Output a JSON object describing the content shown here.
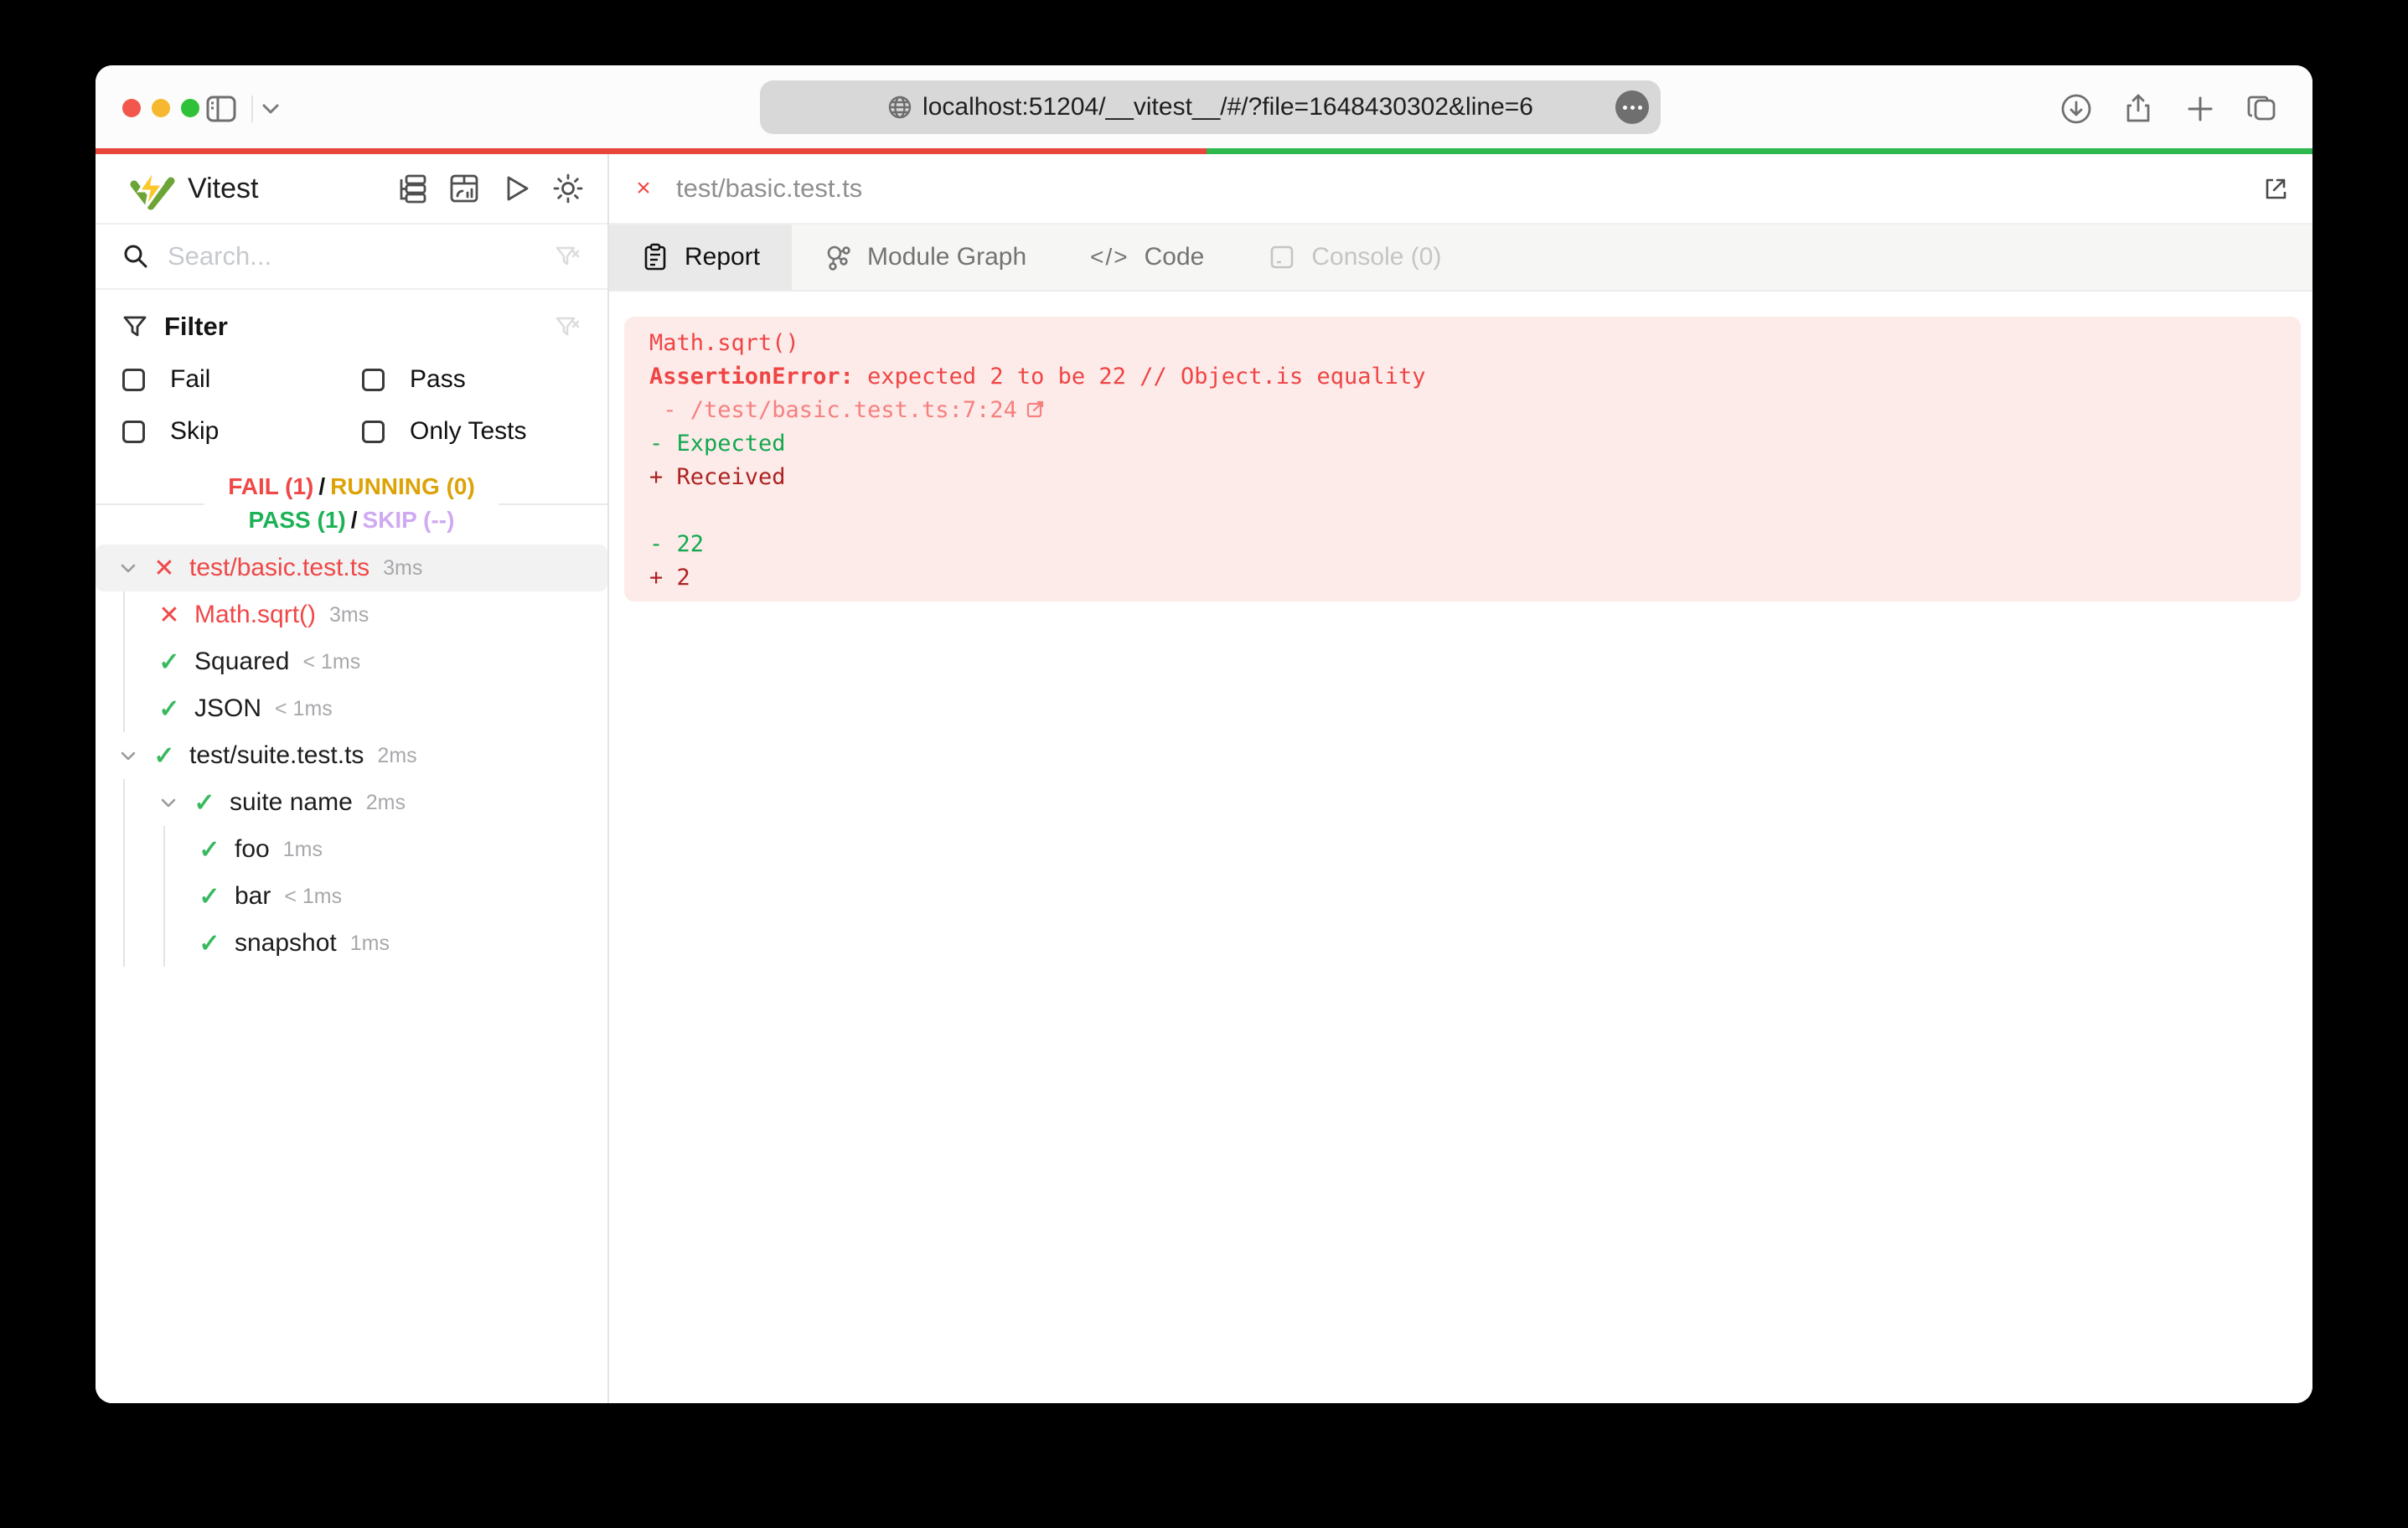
{
  "browser": {
    "url": "localhost:51204/__vitest__/#/?file=1648430302&line=6",
    "toolbar_icons": [
      "sidebar-toggle",
      "chevron-down",
      "globe",
      "page-settings-ellipsis",
      "downloads",
      "share",
      "new-tab",
      "tab-overview"
    ],
    "progress_colors": {
      "fail": "#e8453c",
      "pass": "#2eb84e"
    }
  },
  "app": {
    "title": "Vitest",
    "header_icons": [
      "list-tree",
      "dashboard",
      "run-all",
      "theme-toggle"
    ],
    "search": {
      "placeholder": "Search...",
      "value": ""
    },
    "filter": {
      "title": "Filter",
      "options": [
        "Fail",
        "Pass",
        "Skip",
        "Only Tests"
      ],
      "checked": [
        false,
        false,
        false,
        false
      ]
    },
    "summary": {
      "fail": "FAIL (1)",
      "running": "RUNNING (0)",
      "pass": "PASS (1)",
      "skip": "SKIP (--)",
      "sep": "/"
    },
    "tree": [
      {
        "name": "test/basic.test.ts",
        "duration": "3ms",
        "status": "fail",
        "depth": 0,
        "expandable": true,
        "selected": true
      },
      {
        "name": "Math.sqrt()",
        "duration": "3ms",
        "status": "fail",
        "depth": 1
      },
      {
        "name": "Squared",
        "duration": "< 1ms",
        "status": "pass",
        "depth": 1
      },
      {
        "name": "JSON",
        "duration": "< 1ms",
        "status": "pass",
        "depth": 1
      },
      {
        "name": "test/suite.test.ts",
        "duration": "2ms",
        "status": "pass",
        "depth": 0,
        "expandable": true
      },
      {
        "name": "suite name",
        "duration": "2ms",
        "status": "pass",
        "depth": 1,
        "expandable": true
      },
      {
        "name": "foo",
        "duration": "1ms",
        "status": "pass",
        "depth": 2
      },
      {
        "name": "bar",
        "duration": "< 1ms",
        "status": "pass",
        "depth": 2
      },
      {
        "name": "snapshot",
        "duration": "1ms",
        "status": "pass",
        "depth": 2
      }
    ],
    "file_tab": {
      "close": "×",
      "label": "test/basic.test.ts"
    },
    "tabs": [
      {
        "label": "Report",
        "active": true
      },
      {
        "label": "Module Graph"
      },
      {
        "label": "Code"
      },
      {
        "label": "Console (0)",
        "disabled": true
      }
    ],
    "report": {
      "test_title": "Math.sqrt()",
      "error_name": "AssertionError: ",
      "error_message": "expected 2 to be 22 // Object.is equality",
      "location": " - /test/basic.test.ts:7:24",
      "diff": {
        "expected_label": "- Expected",
        "received_label": "+ Received",
        "expected_value": "- 22",
        "received_value": "+ 2"
      }
    },
    "colors": {
      "fail": "#f04747",
      "pass": "#1eb257",
      "running": "#dca307",
      "skip": "#cfa9f2",
      "panel_bg": "#fdebe9"
    }
  }
}
